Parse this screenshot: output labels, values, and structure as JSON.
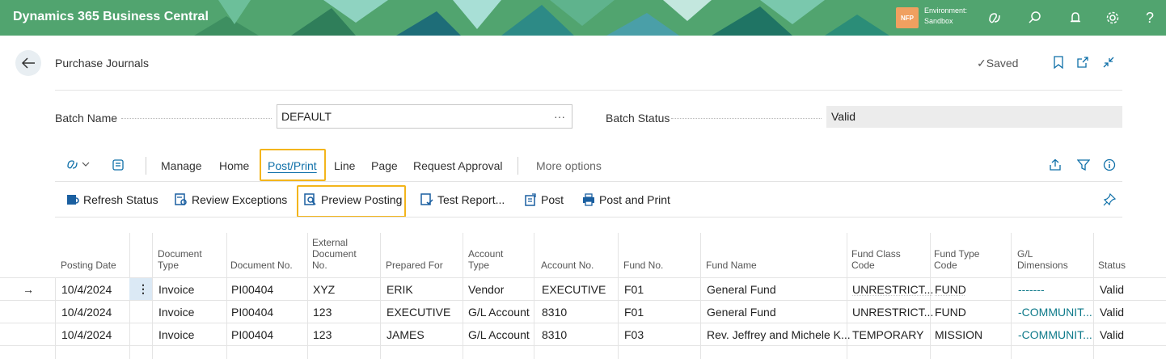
{
  "app": {
    "brand": "Dynamics 365 Business Central",
    "env_badge": "NFP",
    "env_label": "Environment:",
    "env_name": "Sandbox",
    "topbar_icons": [
      "copilot-icon",
      "search-icon",
      "bell-icon",
      "gear-icon",
      "help-icon"
    ]
  },
  "header": {
    "title": "Purchase Journals",
    "saved": "Saved"
  },
  "batch": {
    "name_label": "Batch Name",
    "name_value": "DEFAULT",
    "name_ellipsis": "···",
    "status_label": "Batch Status",
    "status_value": "Valid"
  },
  "actions": {
    "tabs": [
      "Manage",
      "Home",
      "Post/Print",
      "Line",
      "Page",
      "Request Approval",
      "More options"
    ],
    "selected_tab": "Post/Print",
    "sub_actions": [
      "Refresh Status",
      "Review Exceptions",
      "Preview Posting",
      "Test Report...",
      "Post",
      "Post and Print"
    ]
  },
  "grid": {
    "columns": [
      [
        "Posting Date"
      ],
      [
        "Document",
        "Type"
      ],
      [
        "Document No."
      ],
      [
        "External",
        "Document",
        "No."
      ],
      [
        "Prepared For"
      ],
      [
        "Account",
        "Type"
      ],
      [
        "Account No."
      ],
      [
        "Fund No."
      ],
      [
        "Fund Name"
      ],
      [
        "Fund Class",
        "Code"
      ],
      [
        "Fund Type",
        "Code"
      ],
      [
        "G/L",
        "Dimensions"
      ],
      [
        "Status"
      ]
    ],
    "rows": [
      [
        "10/4/2024",
        "Invoice",
        "PI00404",
        "XYZ",
        "ERIK",
        "Vendor",
        "EXECUTIVE",
        "F01",
        "General Fund",
        "UNRESTRICT...",
        "FUND",
        "-------",
        "Valid"
      ],
      [
        "10/4/2024",
        "Invoice",
        "PI00404",
        "123",
        "EXECUTIVE",
        "G/L Account",
        "8310",
        "F01",
        "General Fund",
        "UNRESTRICT...",
        "FUND",
        "-COMMUNIT...",
        "Valid"
      ],
      [
        "10/4/2024",
        "Invoice",
        "PI00404",
        "123",
        "JAMES",
        "G/L Account",
        "8310",
        "F03",
        "Rev. Jeffrey and Michele K...",
        "TEMPORARY",
        "MISSION",
        "-COMMUNIT...",
        "Valid"
      ]
    ],
    "row_marker": "→",
    "row_menu": "⋮"
  },
  "colors": {
    "topbar": "#51a46f",
    "accent_link": "#0e6fa8",
    "highlight": "#f3b51c"
  }
}
